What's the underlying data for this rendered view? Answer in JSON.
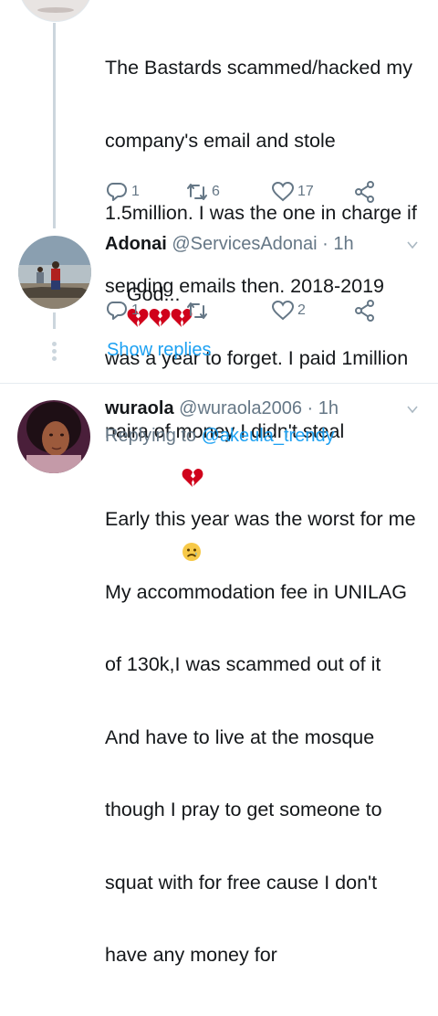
{
  "tweets": [
    {
      "text_lines": [
        "The Bastards scammed/hacked my",
        "company's email and stole",
        "1.5million. I was the one in charge if",
        "sending emails then. 2018-2019",
        "was a year to forget. I paid 1million",
        "naira of money I didn't steal"
      ],
      "actions": {
        "reply_count": "1",
        "retweet_count": "6",
        "like_count": "17"
      }
    },
    {
      "name": "Adonai",
      "handle": "@ServicesAdonai · 1h",
      "text": "God...",
      "actions": {
        "reply_count": "1",
        "retweet_count": "",
        "like_count": "2"
      },
      "show_replies": "Show replies"
    },
    {
      "name": "wuraola",
      "handle": "@wuraola2006 · 1h",
      "replying_prefix": "Replying to",
      "replying_to": "@akeula_trendy",
      "text_lines": [
        "Early this year was the worst for me",
        "My accommodation fee in UNILAG",
        "of 130k,I was scammed out of it",
        "And have to live at the mosque",
        "though I pray to get someone to",
        "squat with for free cause I don't",
        "have any money for"
      ]
    }
  ],
  "colors": {
    "accent": "#1da1f2",
    "muted": "#657786",
    "heart_emoji": "#d0021b"
  }
}
